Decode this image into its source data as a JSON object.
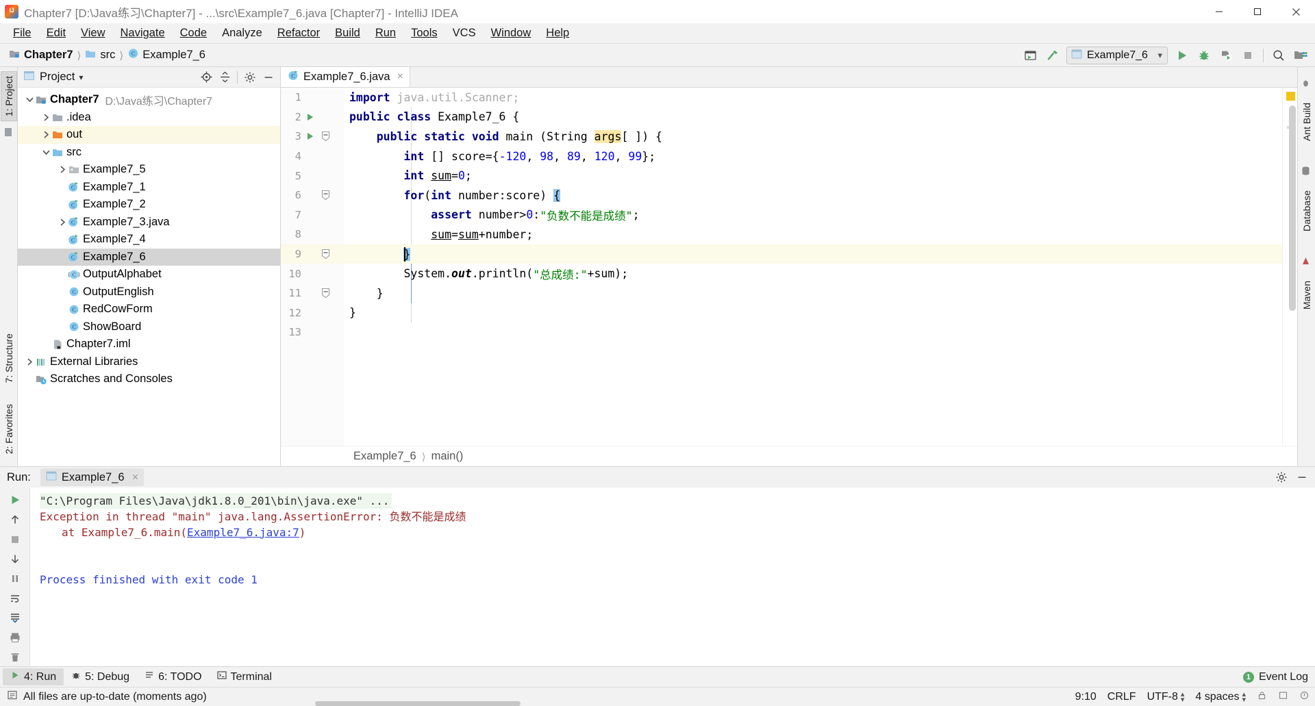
{
  "window": {
    "title": "Chapter7 [D:\\Java练习\\Chapter7] - ...\\src\\Example7_6.java [Chapter7] - IntelliJ IDEA",
    "minimize_label": "Minimize",
    "maximize_label": "Maximize",
    "close_label": "Close"
  },
  "menu": {
    "items": [
      {
        "label": "File"
      },
      {
        "label": "Edit"
      },
      {
        "label": "View"
      },
      {
        "label": "Navigate"
      },
      {
        "label": "Code"
      },
      {
        "label": "Analyze"
      },
      {
        "label": "Refactor"
      },
      {
        "label": "Build"
      },
      {
        "label": "Run"
      },
      {
        "label": "Tools"
      },
      {
        "label": "VCS"
      },
      {
        "label": "Window"
      },
      {
        "label": "Help"
      }
    ]
  },
  "navbar": {
    "breadcrumbs": [
      {
        "label": "Chapter7",
        "icon": "module-icon",
        "bold": true
      },
      {
        "label": "src",
        "icon": "source-folder-icon",
        "bold": false
      },
      {
        "label": "Example7_6",
        "icon": "java-class-icon",
        "bold": false
      }
    ],
    "run_config": {
      "label": "Example7_6",
      "icon": "run-config-icon",
      "dropdown": "▾"
    },
    "buttons": [
      {
        "name": "select-run-config-icon",
        "title": "Select Run/Debug Configuration"
      },
      {
        "name": "build-hammer-icon",
        "title": "Build Project"
      },
      {
        "name": "run-icon",
        "title": "Run 'Example7_6'"
      },
      {
        "name": "debug-icon",
        "title": "Debug 'Example7_6'"
      },
      {
        "name": "run-with-coverage-icon",
        "title": "Run with Coverage"
      },
      {
        "name": "stop-icon",
        "title": "Stop"
      },
      {
        "name": "search-everywhere-icon",
        "title": "Search Everywhere"
      },
      {
        "name": "project-structure-icon",
        "title": "Project Structure"
      }
    ]
  },
  "left_strip": {
    "tabs": [
      {
        "label": "1: Project",
        "selected": true
      }
    ],
    "bottom_tabs": [
      {
        "label": "7: Structure"
      },
      {
        "label": "2: Favorites"
      }
    ]
  },
  "right_strip": {
    "tabs": [
      {
        "label": "Ant Build"
      },
      {
        "label": "Database"
      },
      {
        "label": "Maven"
      }
    ]
  },
  "project_panel": {
    "title": "Project",
    "dropdown": "▾",
    "header_buttons": [
      {
        "name": "locate-target-icon",
        "title": "Select Opened File"
      },
      {
        "name": "collapse-all-icon",
        "title": "Collapse All"
      },
      {
        "name": "settings-gear-icon",
        "title": "Settings"
      },
      {
        "name": "hide-panel-icon",
        "title": "Hide"
      }
    ],
    "tree": [
      {
        "label": "Chapter7",
        "sub": "D:\\Java练习\\Chapter7",
        "icon": "module-icon",
        "arrow": "expanded",
        "indent": 0,
        "bold": true,
        "state": "normal"
      },
      {
        "label": ".idea",
        "sub": "",
        "icon": "folder-icon",
        "arrow": "collapsed",
        "indent": 1,
        "bold": false,
        "state": "normal"
      },
      {
        "label": "out",
        "sub": "",
        "icon": "folder-excluded-icon",
        "arrow": "collapsed",
        "indent": 1,
        "bold": false,
        "state": "highlight"
      },
      {
        "label": "src",
        "sub": "",
        "icon": "source-folder-icon",
        "arrow": "expanded",
        "indent": 1,
        "bold": false,
        "state": "normal"
      },
      {
        "label": "Example7_5",
        "sub": "",
        "icon": "package-icon",
        "arrow": "collapsed",
        "indent": 2,
        "bold": false,
        "state": "normal"
      },
      {
        "label": "Example7_1",
        "sub": "",
        "icon": "java-class-runnable-icon",
        "arrow": "none",
        "indent": 2,
        "bold": false,
        "state": "normal"
      },
      {
        "label": "Example7_2",
        "sub": "",
        "icon": "java-class-runnable-icon",
        "arrow": "none",
        "indent": 2,
        "bold": false,
        "state": "normal"
      },
      {
        "label": "Example7_3.java",
        "sub": "",
        "icon": "java-class-runnable-icon",
        "arrow": "collapsed",
        "indent": 2,
        "bold": false,
        "state": "normal"
      },
      {
        "label": "Example7_4",
        "sub": "",
        "icon": "java-class-runnable-icon",
        "arrow": "none",
        "indent": 2,
        "bold": false,
        "state": "normal"
      },
      {
        "label": "Example7_6",
        "sub": "",
        "icon": "java-class-runnable-icon",
        "arrow": "none",
        "indent": 2,
        "bold": false,
        "state": "selected"
      },
      {
        "label": "OutputAlphabet",
        "sub": "",
        "icon": "java-class-abstract-icon",
        "arrow": "none",
        "indent": 2,
        "bold": false,
        "state": "normal"
      },
      {
        "label": "OutputEnglish",
        "sub": "",
        "icon": "java-class-icon",
        "arrow": "none",
        "indent": 2,
        "bold": false,
        "state": "normal"
      },
      {
        "label": "RedCowForm",
        "sub": "",
        "icon": "java-class-icon",
        "arrow": "none",
        "indent": 2,
        "bold": false,
        "state": "normal"
      },
      {
        "label": "ShowBoard",
        "sub": "",
        "icon": "java-class-icon",
        "arrow": "none",
        "indent": 2,
        "bold": false,
        "state": "normal"
      },
      {
        "label": "Chapter7.iml",
        "sub": "",
        "icon": "iml-file-icon",
        "arrow": "none",
        "indent": 1,
        "bold": false,
        "state": "normal"
      },
      {
        "label": "External Libraries",
        "sub": "",
        "icon": "library-icon",
        "arrow": "collapsed",
        "indent": 0,
        "bold": false,
        "state": "normal"
      },
      {
        "label": "Scratches and Consoles",
        "sub": "",
        "icon": "scratches-icon",
        "arrow": "none",
        "indent": 0,
        "bold": false,
        "state": "normal"
      }
    ]
  },
  "editor": {
    "tabs": [
      {
        "label": "Example7_6.java",
        "icon": "java-class-runnable-icon",
        "close": "×",
        "active": true
      }
    ],
    "lines": [
      {
        "num": "1",
        "run": false,
        "fold": "",
        "current": false,
        "tokens": [
          {
            "t": "import ",
            "c": "kw"
          },
          {
            "t": "java.util.Scanner;",
            "c": "grey"
          }
        ]
      },
      {
        "num": "2",
        "run": true,
        "fold": "",
        "current": false,
        "tokens": [
          {
            "t": "public class ",
            "c": "kw"
          },
          {
            "t": "Example7_6 {",
            "c": "plain"
          }
        ]
      },
      {
        "num": "3",
        "run": true,
        "fold": "minus",
        "current": false,
        "tokens": [
          {
            "t": "    ",
            "c": "plain"
          },
          {
            "t": "public static void ",
            "c": "kw"
          },
          {
            "t": "main (String ",
            "c": "plain"
          },
          {
            "t": "args",
            "c": "argh"
          },
          {
            "t": "[ ]) {",
            "c": "plain"
          }
        ]
      },
      {
        "num": "4",
        "run": false,
        "fold": "",
        "current": false,
        "tokens": [
          {
            "t": "        ",
            "c": "plain"
          },
          {
            "t": "int ",
            "c": "kw"
          },
          {
            "t": "[] score={",
            "c": "plain"
          },
          {
            "t": "-120",
            "c": "num"
          },
          {
            "t": ", ",
            "c": "plain"
          },
          {
            "t": "98",
            "c": "num"
          },
          {
            "t": ", ",
            "c": "plain"
          },
          {
            "t": "89",
            "c": "num"
          },
          {
            "t": ", ",
            "c": "plain"
          },
          {
            "t": "120",
            "c": "num"
          },
          {
            "t": ", ",
            "c": "plain"
          },
          {
            "t": "99",
            "c": "num"
          },
          {
            "t": "};",
            "c": "plain"
          }
        ]
      },
      {
        "num": "5",
        "run": false,
        "fold": "",
        "current": false,
        "tokens": [
          {
            "t": "        ",
            "c": "plain"
          },
          {
            "t": "int ",
            "c": "kw"
          },
          {
            "t": "sum",
            "c": "und"
          },
          {
            "t": "=",
            "c": "plain"
          },
          {
            "t": "0",
            "c": "num"
          },
          {
            "t": ";",
            "c": "plain"
          }
        ]
      },
      {
        "num": "6",
        "run": false,
        "fold": "minus",
        "current": false,
        "tokens": [
          {
            "t": "        ",
            "c": "plain"
          },
          {
            "t": "for",
            "c": "kw"
          },
          {
            "t": "(",
            "c": "plain"
          },
          {
            "t": "int ",
            "c": "kw"
          },
          {
            "t": "number:score) ",
            "c": "plain"
          },
          {
            "t": "{",
            "c": "bmatch"
          }
        ]
      },
      {
        "num": "7",
        "run": false,
        "fold": "",
        "current": false,
        "tokens": [
          {
            "t": "            ",
            "c": "plain"
          },
          {
            "t": "assert ",
            "c": "kw"
          },
          {
            "t": "number>",
            "c": "plain"
          },
          {
            "t": "0",
            "c": "num"
          },
          {
            "t": ":",
            "c": "plain"
          },
          {
            "t": "\"负数不能是成绩\"",
            "c": "str"
          },
          {
            "t": ";",
            "c": "plain"
          }
        ]
      },
      {
        "num": "8",
        "run": false,
        "fold": "",
        "current": false,
        "tokens": [
          {
            "t": "            ",
            "c": "plain"
          },
          {
            "t": "sum",
            "c": "und"
          },
          {
            "t": "=",
            "c": "plain"
          },
          {
            "t": "sum",
            "c": "und"
          },
          {
            "t": "+number;",
            "c": "plain"
          }
        ]
      },
      {
        "num": "9",
        "run": false,
        "fold": "minus",
        "current": true,
        "tokens": [
          {
            "t": "        ",
            "c": "plain"
          },
          {
            "t": "}",
            "c": "bmatch"
          }
        ]
      },
      {
        "num": "10",
        "run": false,
        "fold": "",
        "current": false,
        "tokens": [
          {
            "t": "        System.",
            "c": "plain"
          },
          {
            "t": "out",
            "c": "fld"
          },
          {
            "t": ".println(",
            "c": "plain"
          },
          {
            "t": "\"总成绩:\"",
            "c": "str"
          },
          {
            "t": "+sum);",
            "c": "plain"
          }
        ]
      },
      {
        "num": "11",
        "run": false,
        "fold": "minus",
        "current": false,
        "tokens": [
          {
            "t": "    }",
            "c": "plain"
          }
        ]
      },
      {
        "num": "12",
        "run": false,
        "fold": "",
        "current": false,
        "tokens": [
          {
            "t": "}",
            "c": "plain"
          }
        ]
      },
      {
        "num": "13",
        "run": false,
        "fold": "",
        "current": false,
        "tokens": []
      }
    ],
    "breadcrumb": [
      {
        "label": "Example7_6"
      },
      {
        "label": "main()"
      }
    ]
  },
  "run_panel": {
    "label": "Run:",
    "tab": {
      "label": "Example7_6",
      "icon": "run-config-icon",
      "close": "×"
    },
    "header_buttons": [
      {
        "name": "settings-gear-icon",
        "title": "Settings"
      },
      {
        "name": "hide-panel-icon",
        "title": "Hide"
      }
    ],
    "toolbar_buttons": [
      {
        "name": "rerun-icon",
        "title": "Rerun 'Example7_6'"
      },
      {
        "name": "up-stacktrace-icon",
        "title": "Up the Stack Trace"
      },
      {
        "name": "stop-icon",
        "title": "Stop"
      },
      {
        "name": "down-stacktrace-icon",
        "title": "Down the Stack Trace"
      },
      {
        "name": "pause-icon",
        "title": "Pause Output"
      },
      {
        "name": "soft-wrap-icon",
        "title": "Use Soft Wraps"
      },
      {
        "name": "scroll-to-end-icon",
        "title": "Scroll to End"
      },
      {
        "name": "print-icon",
        "title": "Print"
      },
      {
        "name": "clear-all-icon",
        "title": "Clear All"
      }
    ],
    "console": [
      {
        "text": "\"C:\\Program Files\\Java\\jdk1.8.0_201\\bin\\java.exe\" ...",
        "style": "command"
      },
      {
        "text": "Exception in thread \"main\" java.lang.AssertionError: 负数不能是成绩",
        "style": "error"
      },
      {
        "text": "at Example7_6.main(",
        "style": "error-indent",
        "link": "Example7_6.java:7",
        "tail": ")"
      },
      {
        "text": "",
        "style": "blank"
      },
      {
        "text": "",
        "style": "blank"
      },
      {
        "text": "Process finished with exit code 1",
        "style": "ok"
      }
    ]
  },
  "bottom_bar": {
    "tabs": [
      {
        "label": "4: Run",
        "icon": "run-icon",
        "selected": true
      },
      {
        "label": "5: Debug",
        "icon": "debug-icon",
        "selected": false
      },
      {
        "label": "6: TODO",
        "icon": "todo-icon",
        "selected": false
      },
      {
        "label": "Terminal",
        "icon": "terminal-icon",
        "selected": false
      }
    ],
    "event_log": {
      "label": "Event Log",
      "badge": "1"
    }
  },
  "status_bar": {
    "message": "All files are up-to-date (moments ago)",
    "caret": "9:10",
    "line_separator": "CRLF",
    "encoding": "UTF-8",
    "indent": "4 spaces",
    "icons": [
      {
        "name": "lock-icon"
      },
      {
        "name": "readonly-icon"
      },
      {
        "name": "inspection-icon"
      }
    ]
  },
  "colors": {
    "accent_green": "#59a869",
    "keyword_blue": "#000080",
    "string_green": "#008000",
    "number_blue": "#0000ff",
    "error_red": "#9c2c2c",
    "link_blue": "#2b3fd4",
    "selection_gray": "#d4d4d4",
    "current_line": "#fcfae8"
  }
}
